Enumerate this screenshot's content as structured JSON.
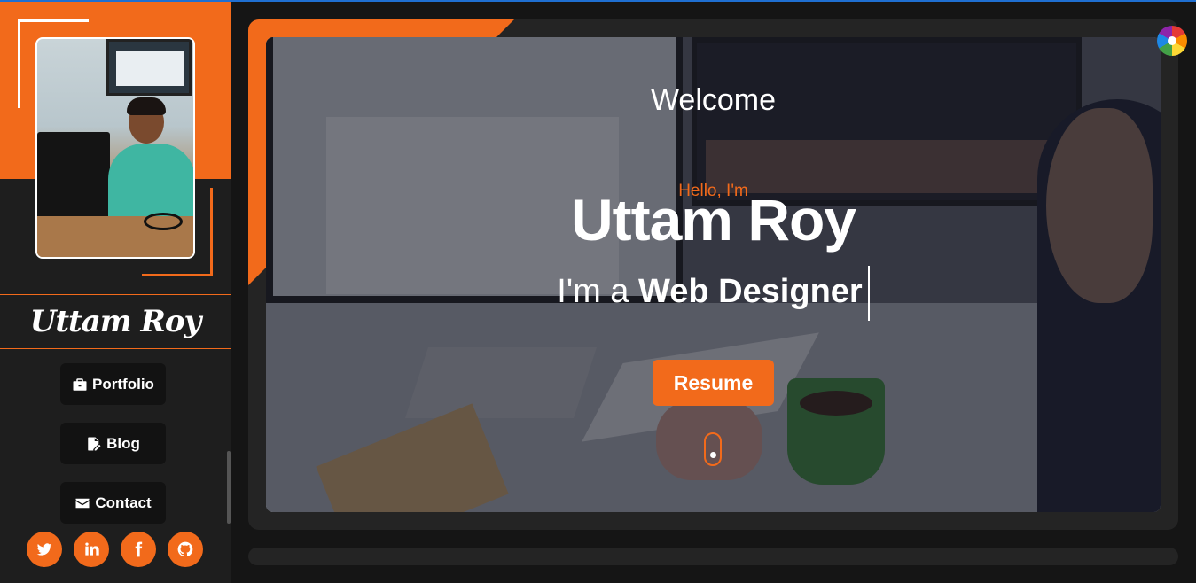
{
  "sidebar": {
    "name": "Uttam Roy",
    "nav": [
      {
        "label": "Portfolio",
        "icon": "briefcase-icon"
      },
      {
        "label": "Blog",
        "icon": "file-edit-icon"
      },
      {
        "label": "Contact",
        "icon": "envelope-icon"
      }
    ],
    "socials": [
      "twitter-icon",
      "linkedin-icon",
      "facebook-icon",
      "github-icon"
    ]
  },
  "hero": {
    "welcome": "Welcome",
    "greeting": "Hello, I'm",
    "name": "Uttam Roy",
    "role_prefix": "I'm a",
    "role": "Web Designer",
    "resume_label": "Resume"
  },
  "colors": {
    "accent": "#f26a1b",
    "background": "#151515",
    "panel": "#242424"
  }
}
